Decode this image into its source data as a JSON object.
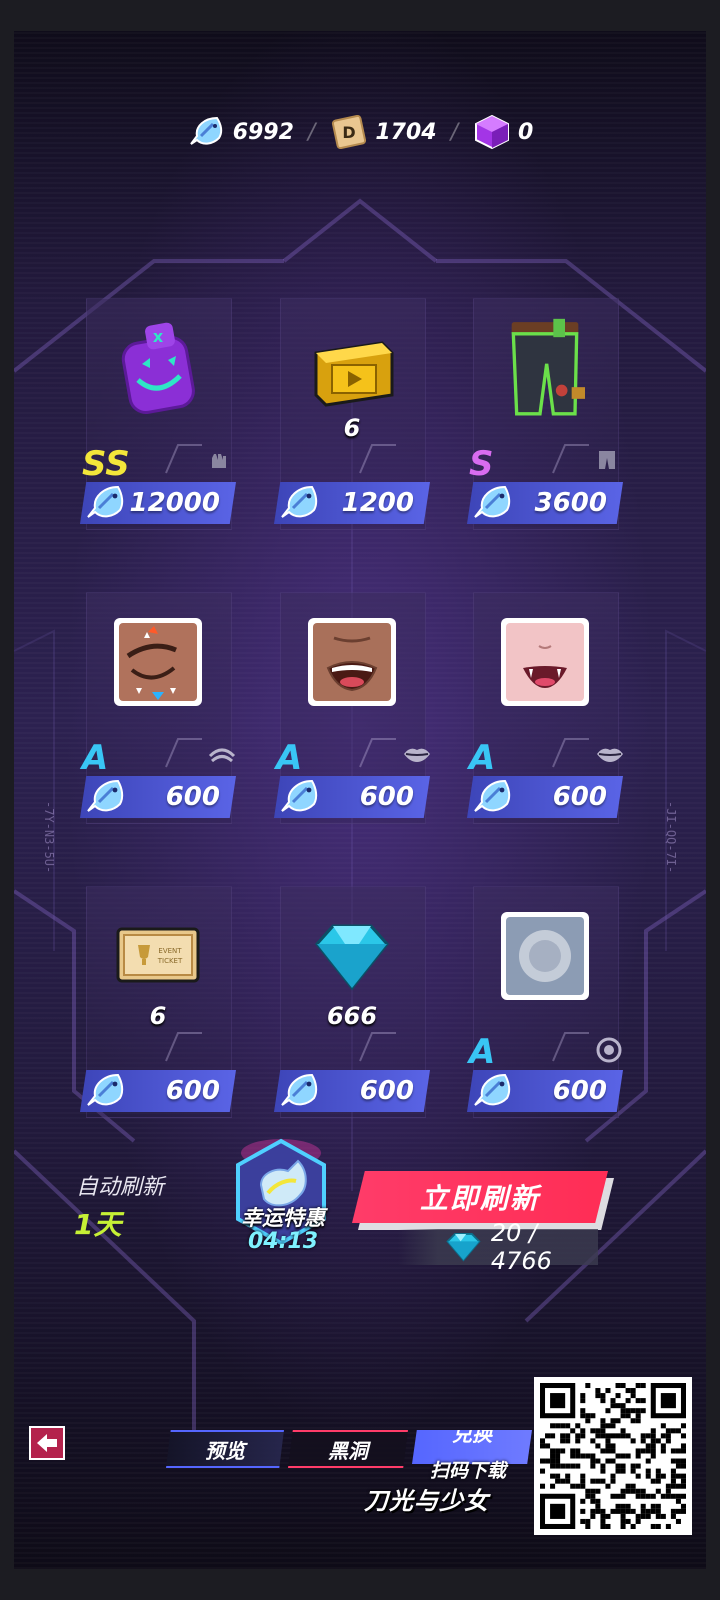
{
  "currencies": [
    {
      "icon": "fish-coin-icon",
      "value": "6992"
    },
    {
      "icon": "d-token-icon",
      "value": "1704"
    },
    {
      "icon": "purple-cube-icon",
      "value": "0"
    }
  ],
  "side_codes": {
    "left": "-7Y-N3-5U-",
    "right": "-JI-QQ-7I-"
  },
  "items": [
    {
      "art": "pumpkin-backpack-icon",
      "qty": "",
      "rank": "SS",
      "rank_color": "#f3e63a",
      "category": "glove-icon",
      "price": "12000"
    },
    {
      "art": "gold-video-box-icon",
      "qty": "6",
      "rank": "",
      "rank_color": "",
      "category": "",
      "price": "1200"
    },
    {
      "art": "cargo-pants-icon",
      "qty": "",
      "rank": "S",
      "rank_color": "#d86cf0",
      "category": "pants-icon",
      "price": "3600"
    },
    {
      "art": "wink-eye-face-icon",
      "qty": "",
      "rank": "A",
      "rank_color": "#39c6f5",
      "category": "eye-icon",
      "price": "600"
    },
    {
      "art": "open-mouth-face-icon",
      "qty": "",
      "rank": "A",
      "rank_color": "#39c6f5",
      "category": "lips-icon",
      "price": "600"
    },
    {
      "art": "fang-mouth-face-icon",
      "qty": "",
      "rank": "A",
      "rank_color": "#39c6f5",
      "category": "lips-icon",
      "price": "600"
    },
    {
      "art": "event-ticket-icon",
      "qty": "6",
      "rank": "",
      "rank_color": "",
      "category": "",
      "price": "600"
    },
    {
      "art": "blue-gem-icon",
      "qty": "666",
      "rank": "",
      "rank_color": "",
      "category": "",
      "price": "600"
    },
    {
      "art": "gray-circle-item-icon",
      "qty": "",
      "rank": "A",
      "rank_color": "#39c6f5",
      "category": "target-icon",
      "price": "600"
    }
  ],
  "auto_refresh": {
    "label": "自动刷新",
    "value": "1天"
  },
  "lucky_deal": {
    "title": "幸运特惠",
    "timer": "04:13"
  },
  "refresh_button": {
    "label": "立即刷新",
    "cost": "20 / 4766"
  },
  "tabs": {
    "preview": "预览",
    "blackhole": "黑洞",
    "exchange": "兑换"
  },
  "promo": {
    "subtitle": "扫码下载",
    "title": "刀光与少女"
  },
  "colors": {
    "accent_blue": "#5a64e6",
    "accent_red": "#ff2d55",
    "lime": "#c6f035"
  }
}
